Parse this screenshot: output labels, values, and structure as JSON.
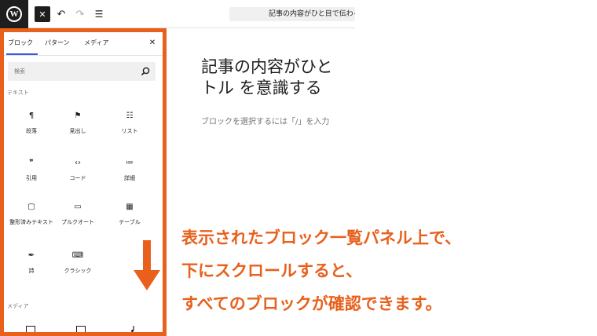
{
  "toolbar": {
    "logo_glyph": "W",
    "close_glyph": "✕",
    "undo_glyph": "↶",
    "redo_glyph": "↷",
    "list_view_glyph": "☰",
    "post_title_chip": "記事の内容がひと目で伝わるタ"
  },
  "inserter": {
    "tabs": [
      "ブロック",
      "パターン",
      "メディア"
    ],
    "active_tab": 0,
    "close_glyph": "✕",
    "search_placeholder": "検索",
    "categories": {
      "text": "テキスト",
      "media": "メディア"
    },
    "blocks": [
      {
        "label": "段落",
        "icon": "paragraph-icon",
        "glyph": "¶"
      },
      {
        "label": "見出し",
        "icon": "bookmark-icon",
        "glyph": "⚑"
      },
      {
        "label": "リスト",
        "icon": "list-icon",
        "glyph": "☷"
      },
      {
        "label": "引用",
        "icon": "quote-icon",
        "glyph": "❞"
      },
      {
        "label": "コード",
        "icon": "code-icon",
        "glyph": "‹›"
      },
      {
        "label": "詳細",
        "icon": "details-icon",
        "glyph": "≔"
      },
      {
        "label": "整形済みテキスト",
        "icon": "preformatted-icon",
        "glyph": "▢"
      },
      {
        "label": "プルクオート",
        "icon": "pullquote-icon",
        "glyph": "▭"
      },
      {
        "label": "テーブル",
        "icon": "table-icon",
        "glyph": "▦"
      },
      {
        "label": "詩",
        "icon": "feather-icon",
        "glyph": "✒"
      },
      {
        "label": "クラシック",
        "icon": "keyboard-icon",
        "glyph": "⌨"
      }
    ]
  },
  "editor": {
    "heading_lines": [
      "記事の内容がひと",
      "トル を意識する"
    ],
    "paragraph_placeholder": "ブロックを選択するには「/」を入力"
  },
  "annotation": {
    "lines": [
      "表示されたブロック一覧パネル上で、",
      "下にスクロールすると、",
      "すべてのブロックが確認できます。"
    ],
    "color": "#e8601c"
  }
}
